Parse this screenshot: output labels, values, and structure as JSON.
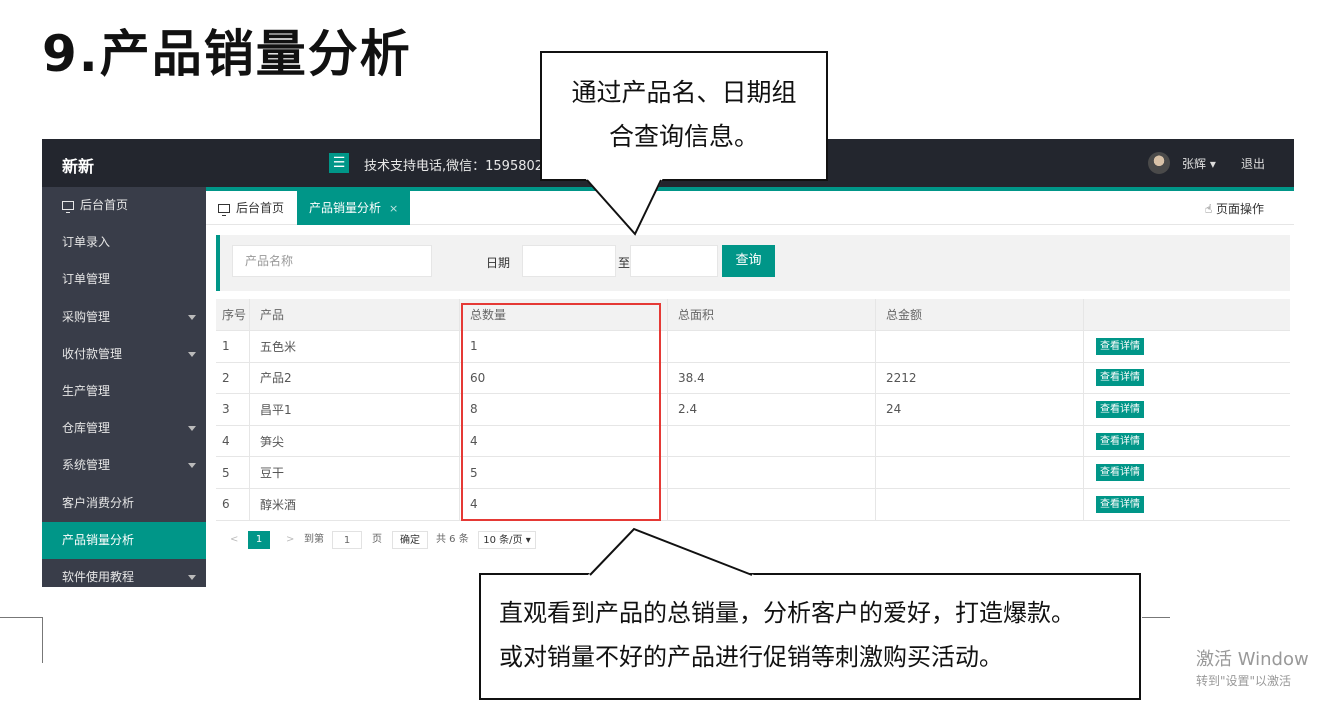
{
  "slide_title": "9.产品销量分析",
  "topbar": {
    "brand": "新新",
    "support": "技术支持电话,微信：15958021",
    "username": "张辉",
    "logout": "退出"
  },
  "sidebar": {
    "items": [
      {
        "label": "后台首页",
        "icon": "monitor-icon",
        "caret": false
      },
      {
        "label": "订单录入",
        "caret": false
      },
      {
        "label": "订单管理",
        "caret": false
      },
      {
        "label": "采购管理",
        "caret": true
      },
      {
        "label": "收付款管理",
        "caret": true
      },
      {
        "label": "生产管理",
        "caret": false
      },
      {
        "label": "仓库管理",
        "caret": true
      },
      {
        "label": "系统管理",
        "caret": true
      },
      {
        "label": "客户消费分析",
        "caret": false
      },
      {
        "label": "产品销量分析",
        "caret": false,
        "active": true
      },
      {
        "label": "软件使用教程",
        "caret": true
      }
    ]
  },
  "tabs": {
    "home": "后台首页",
    "active": "产品销量分析",
    "close": "×",
    "page_ops": "页面操作"
  },
  "search": {
    "product_placeholder": "产品名称",
    "date_label": "日期",
    "to_label": "至",
    "query_button": "查询"
  },
  "table": {
    "headers": [
      "序号",
      "产品",
      "总数量",
      "总面积",
      "总金额",
      ""
    ],
    "rows": [
      {
        "no": "1",
        "product": "五色米",
        "qty": "1",
        "area": "",
        "amount": "",
        "action": "查看详情"
      },
      {
        "no": "2",
        "product": "产品2",
        "qty": "60",
        "area": "38.4",
        "amount": "2212",
        "action": "查看详情"
      },
      {
        "no": "3",
        "product": "昌平1",
        "qty": "8",
        "area": "2.4",
        "amount": "24",
        "action": "查看详情"
      },
      {
        "no": "4",
        "product": "笋尖",
        "qty": "4",
        "area": "",
        "amount": "",
        "action": "查看详情"
      },
      {
        "no": "5",
        "product": "豆干",
        "qty": "5",
        "area": "",
        "amount": "",
        "action": "查看详情"
      },
      {
        "no": "6",
        "product": "醇米酒",
        "qty": "4",
        "area": "",
        "amount": "",
        "action": "查看详情"
      }
    ]
  },
  "pager": {
    "prev": "<",
    "current": "1",
    "next": ">",
    "goto": "到第",
    "page_input": "1",
    "page_unit": "页",
    "confirm": "确定",
    "total": "共 6 条",
    "per_page": "10 条/页"
  },
  "callouts": {
    "top": [
      "通过产品名、日期组",
      "合查询信息。"
    ],
    "bottom": [
      "直观看到产品的总销量，分析客户的爱好，打造爆款。",
      "或对销量不好的产品进行促销等刺激购买活动。"
    ]
  },
  "watermark": {
    "line1": "激活 Window",
    "line2": "转到\"设置\"以激活"
  },
  "colors": {
    "accent": "#009688",
    "topbar": "#23262e",
    "sidebar": "#393d49",
    "highlight": "#e53935"
  }
}
